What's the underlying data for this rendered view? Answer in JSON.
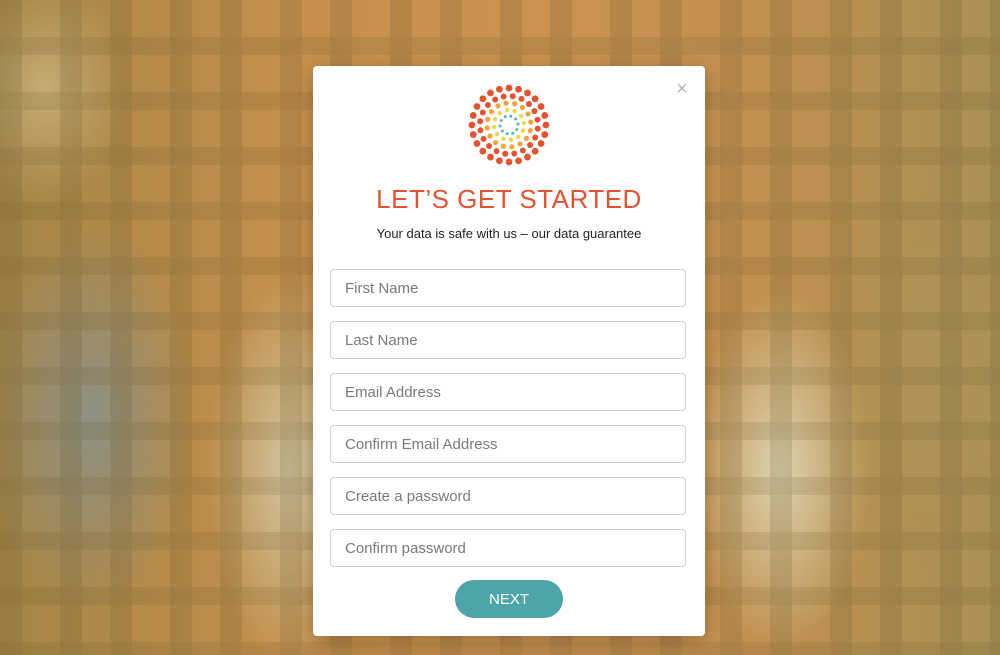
{
  "modal": {
    "title": "LET’S GET STARTED",
    "subtitle": "Your data is safe with us – our data guarantee",
    "close_symbol": "×",
    "fields": [
      {
        "placeholder": "First Name",
        "value": ""
      },
      {
        "placeholder": "Last Name",
        "value": ""
      },
      {
        "placeholder": "Email Address",
        "value": ""
      },
      {
        "placeholder": "Confirm Email Address",
        "value": ""
      },
      {
        "placeholder": "Create a password",
        "value": ""
      },
      {
        "placeholder": "Confirm password",
        "value": ""
      }
    ],
    "next_label": "NEXT",
    "logo_icon": "sunburst-dots-logo"
  },
  "colors": {
    "title": "#e5532e",
    "button": "#4ea5a9",
    "logo_outer": "#e5532e",
    "logo_middle": "#f2a33a",
    "logo_inner": "#f5d54a",
    "logo_center": "#5bb3c1"
  }
}
